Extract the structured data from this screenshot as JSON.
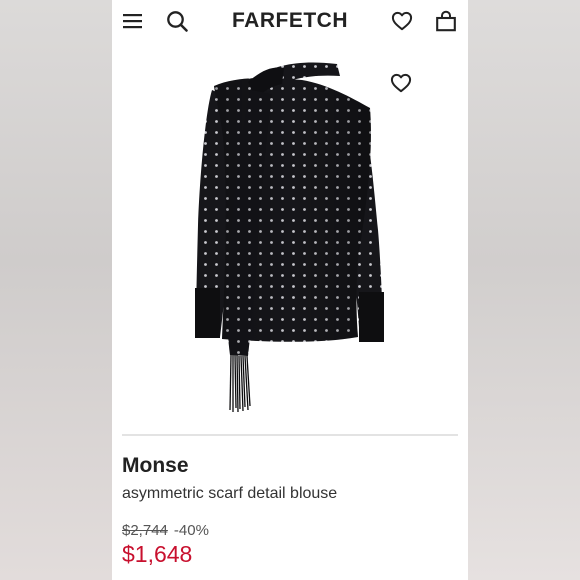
{
  "app": {
    "brand": "FARFETCH",
    "colors": {
      "sale": "#c8102e",
      "text": "#222222",
      "icon": "#222222"
    }
  },
  "header": {
    "icons": [
      "menu-icon",
      "search-icon",
      "heart-icon",
      "shopping-bag-icon"
    ]
  },
  "product": {
    "image": "black-polka-dot-asymmetric-scarf-blouse",
    "wishlist_icon": "heart-icon",
    "designer": "Monse",
    "name": "asymmetric scarf detail blouse",
    "original_price": "$2,744",
    "discount": "-40%",
    "sale_price": "$1,648"
  }
}
